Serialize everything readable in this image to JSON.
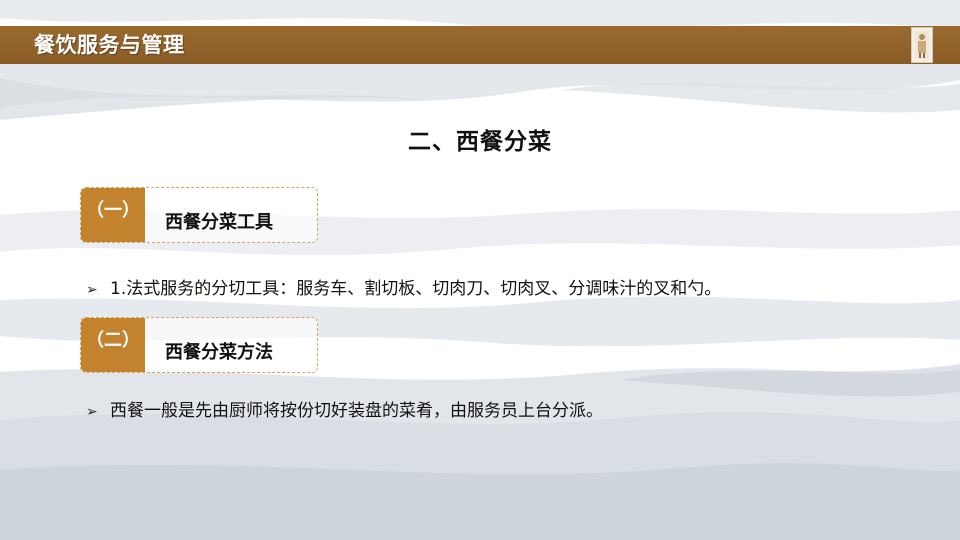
{
  "header": {
    "title": "餐饮服务与管理"
  },
  "slide": {
    "title": "二、西餐分菜"
  },
  "sections": [
    {
      "tag": "（一）",
      "label": "西餐分菜工具"
    },
    {
      "tag": "（二）",
      "label": "西餐分菜方法"
    }
  ],
  "bullets": [
    {
      "icon": "arrow-bullet-icon",
      "text": "1.法式服务的分切工具：服务车、割切板、切肉刀、切肉叉、分调味汁的叉和勺。"
    },
    {
      "icon": "arrow-bullet-icon",
      "text": "西餐一般是先由厨师将按份切好装盘的菜肴，由服务员上台分派。"
    }
  ],
  "colors": {
    "header": "#8a5c26",
    "accent": "#c2822e",
    "border": "#d4a25f"
  }
}
